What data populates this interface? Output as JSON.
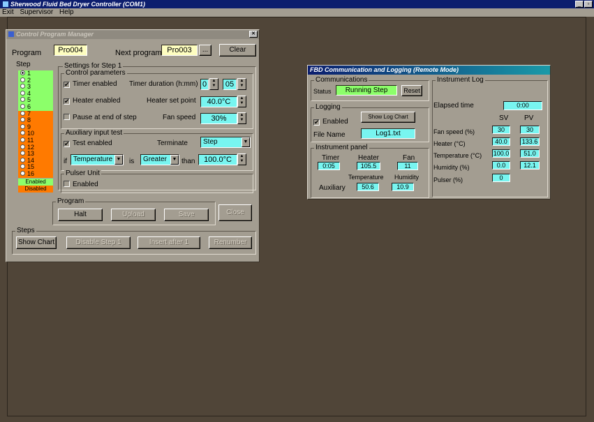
{
  "app": {
    "title": "Sherwood Fluid Bed Dryer Controller (COM1)",
    "min_label": "_",
    "max_label": "▫"
  },
  "menu": [
    "Exit",
    "Supervisor",
    "Help"
  ],
  "cpm": {
    "title": "Control Program Manager",
    "close_label": "✕",
    "program_label": "Program",
    "program_value": "Pro004",
    "next_program_label": "Next program",
    "next_program_value": "Pro003",
    "browse_label": "...",
    "clear_label": "Clear",
    "step_label": "Step",
    "settings_title": "Settings for Step 1",
    "control_params_title": "Control parameters",
    "timer_enabled_label": "Timer enabled",
    "timer_enabled_check": "✔",
    "timer_duration_label": "Timer duration (h:mm)",
    "timer_hours": "0",
    "timer_minutes": "05",
    "heater_enabled_label": "Heater enabled",
    "heater_enabled_check": "✔",
    "heater_setpoint_label": "Heater set point",
    "heater_setpoint_value": "40.0°C",
    "pause_label": "Pause at end of step",
    "fan_speed_label": "Fan speed",
    "fan_speed_value": "30%",
    "aux_title": "Auxiliary input test",
    "test_enabled_label": "Test enabled",
    "test_enabled_check": "✔",
    "terminate_label": "Terminate",
    "terminate_value": "Step",
    "if_label": "if",
    "if_value": "Temperature",
    "is_label": "is",
    "is_value": "Greater",
    "than_label": "than",
    "than_value": "100.0°C",
    "pulser_title": "Pulser Unit",
    "pulser_enabled_label": "Enabled",
    "steps": [
      {
        "num": "1",
        "color": "#8cff6a"
      },
      {
        "num": "2",
        "color": "#8cff6a"
      },
      {
        "num": "3",
        "color": "#8cff6a"
      },
      {
        "num": "4",
        "color": "#8cff6a"
      },
      {
        "num": "5",
        "color": "#8cff6a"
      },
      {
        "num": "6",
        "color": "#8cff6a"
      },
      {
        "num": "7",
        "color": "#ff7a00"
      },
      {
        "num": "8",
        "color": "#ff7a00"
      },
      {
        "num": "9",
        "color": "#ff7a00"
      },
      {
        "num": "10",
        "color": "#ff7a00"
      },
      {
        "num": "11",
        "color": "#ff7a00"
      },
      {
        "num": "12",
        "color": "#ff7a00"
      },
      {
        "num": "13",
        "color": "#ff7a00"
      },
      {
        "num": "14",
        "color": "#ff7a00"
      },
      {
        "num": "15",
        "color": "#ff7a00"
      },
      {
        "num": "16",
        "color": "#ff7a00"
      }
    ],
    "legend_enabled": "Enabled",
    "legend_disabled": "Disabled",
    "program_group_title": "Program",
    "halt_label": "Halt",
    "upload_label": "Upload",
    "save_label": "Save",
    "close_btn_label": "Close",
    "steps_group_title": "Steps",
    "show_chart_label": "Show Chart",
    "disable_step_label": "Disable Step 1",
    "insert_after_label": "Insert after 1",
    "renumber_label": "Renumber"
  },
  "fbd": {
    "title": "FBD Communication and Logging (Remote Mode)",
    "comm_title": "Communications",
    "status_label": "Status",
    "status_value": "Running Step",
    "reset_label": "Reset",
    "logging_title": "Logging",
    "log_enabled_label": "Enabled",
    "log_enabled_check": "✔",
    "show_log_chart_label": "Show Log Chart",
    "file_name_label": "File Name",
    "file_name_value": "Log1.txt",
    "panel_title": "Instrument panel",
    "timer_label": "Timer",
    "timer_value": "0:05",
    "heater_label": "Heater",
    "heater_value": "105.5",
    "fan_label": "Fan",
    "fan_value": "11",
    "temperature_label": "Temperature",
    "humidity_label": "Humidity",
    "auxiliary_label": "Auxiliary",
    "aux_temp_value": "50.6",
    "aux_hum_value": "10.9",
    "log_title": "Instrument Log",
    "elapsed_label": "Elapsed time",
    "elapsed_value": "0:00",
    "sv_label": "SV",
    "pv_label": "PV",
    "rows": [
      {
        "label": "Fan speed (%)",
        "sv": "30",
        "pv": "30"
      },
      {
        "label": "Heater (°C)",
        "sv": "40.0",
        "pv": "133.6"
      },
      {
        "label": "Temperature (°C)",
        "sv": "100.0",
        "pv": "51.0"
      },
      {
        "label": "Humidity (%)",
        "sv": "0.0",
        "pv": "12.1"
      },
      {
        "label": "Pulser (%)",
        "sv": "0",
        "pv": ""
      }
    ]
  }
}
